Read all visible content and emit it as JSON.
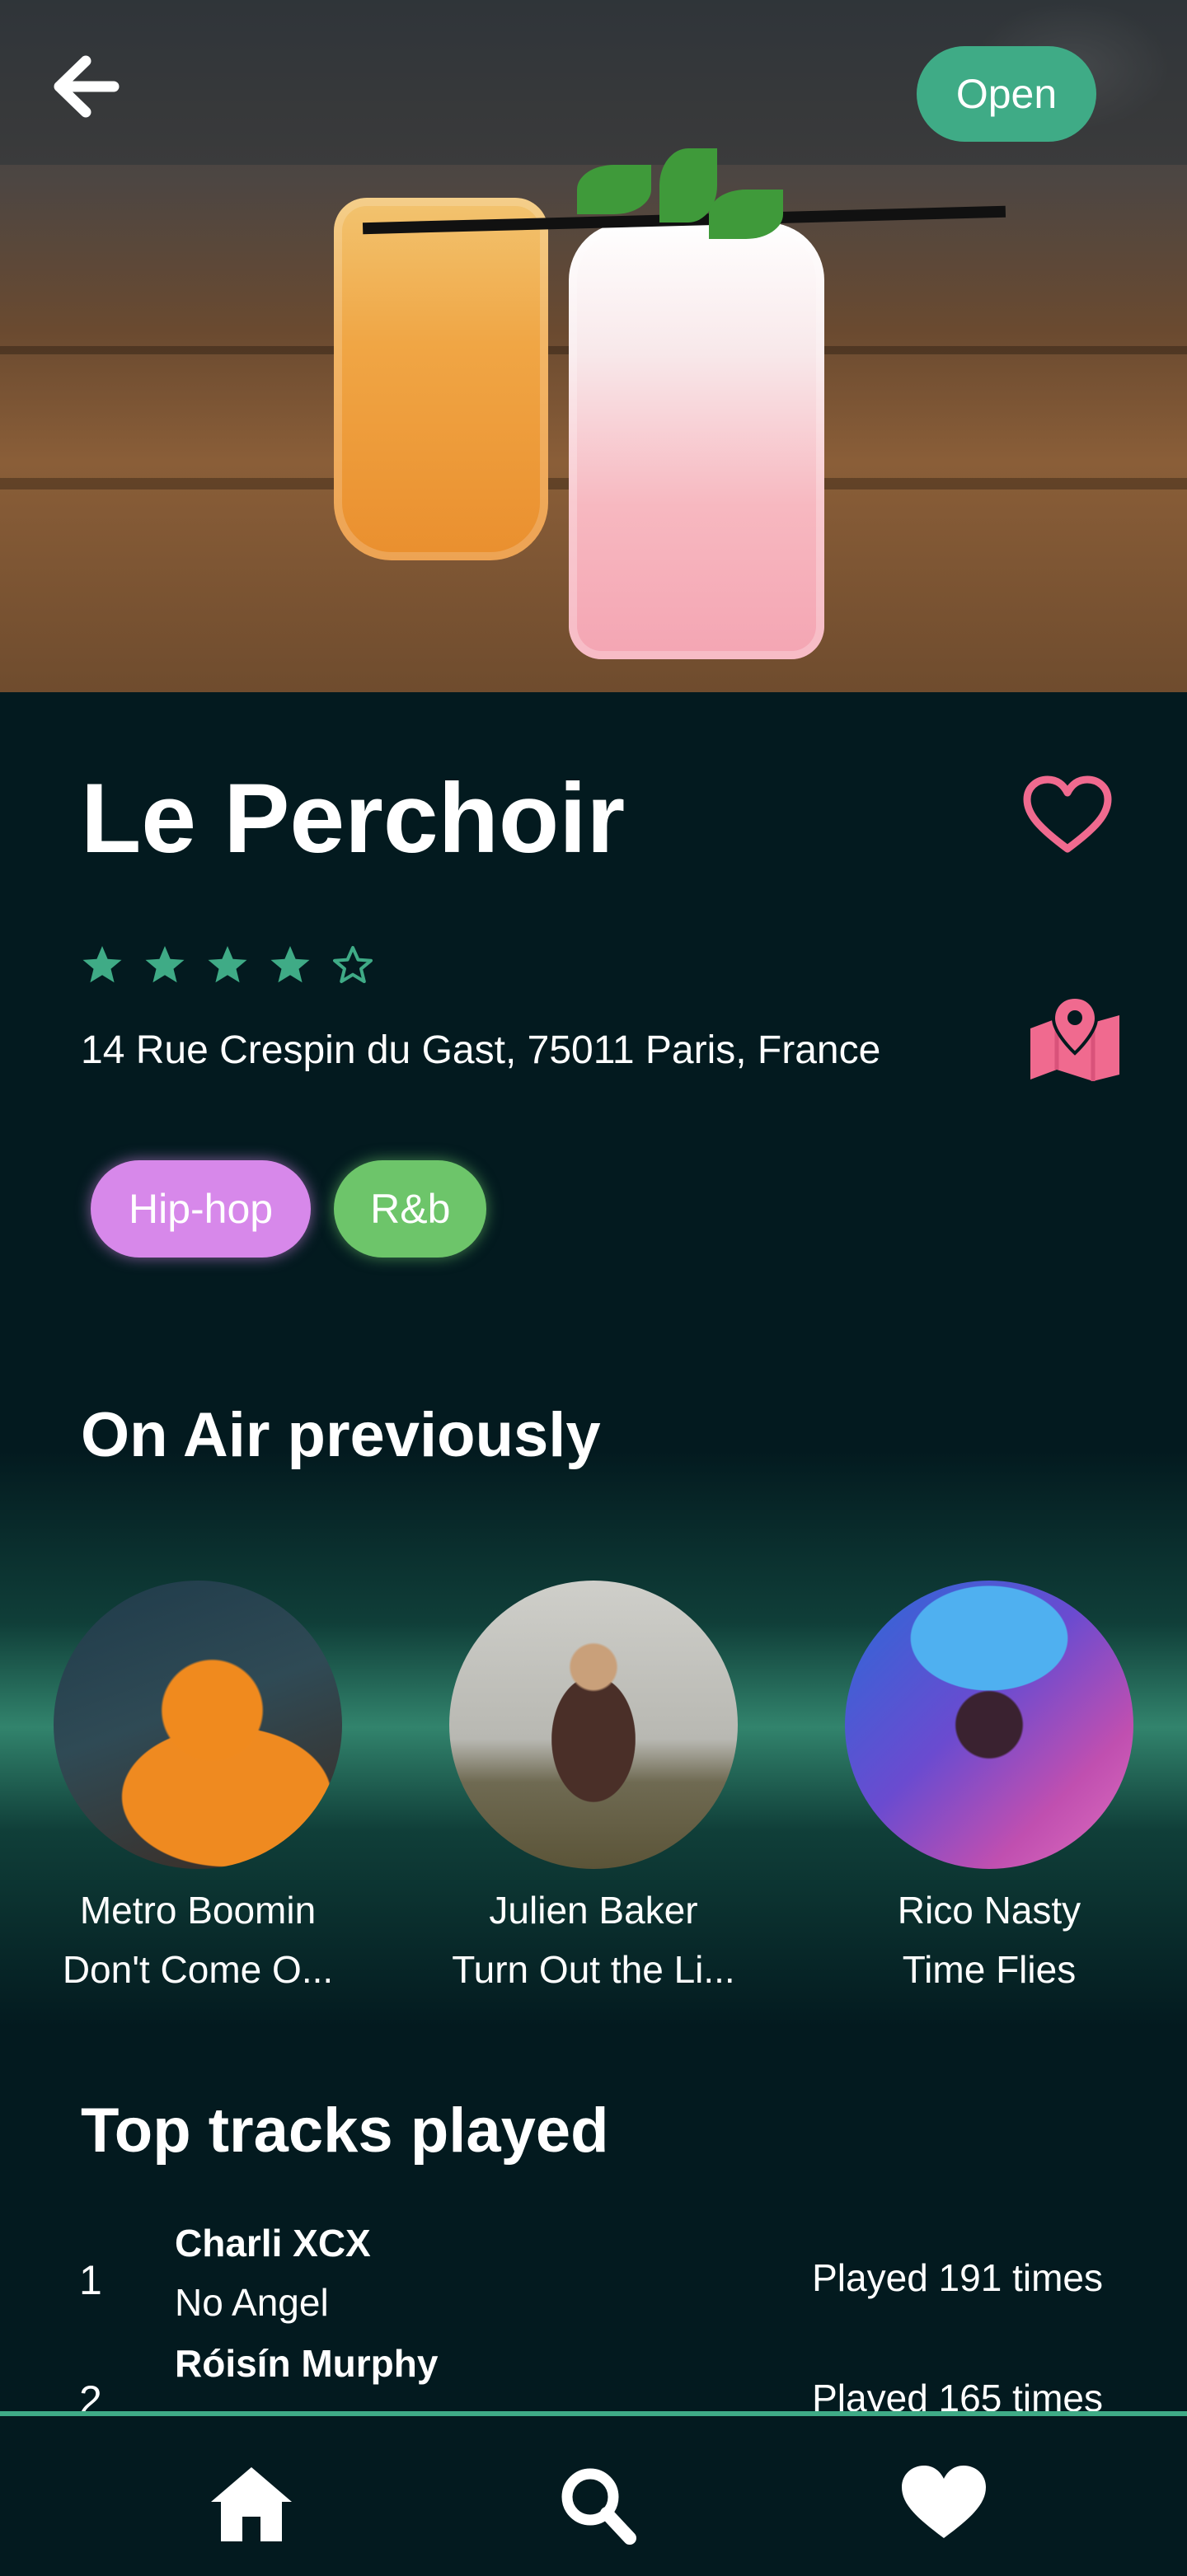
{
  "venue": {
    "status_badge": "Open",
    "name": "Le Perchoir",
    "rating": 4,
    "rating_max": 5,
    "address": "14 Rue Crespin du Gast, 75011 Paris, France",
    "tags": [
      "Hip-hop",
      "R&b"
    ]
  },
  "icons": {
    "back": "arrow-left-icon",
    "favorite": "heart-outline-icon",
    "map": "map-pin-icon",
    "star_filled": "star-filled-icon",
    "star_empty": "star-outline-icon",
    "nav_home": "home-icon",
    "nav_search": "search-icon",
    "nav_favorites": "heart-icon"
  },
  "on_air": {
    "title": "On Air previously",
    "artists": [
      {
        "name": "Metro Boomin",
        "track": "Don't Come O..."
      },
      {
        "name": "Julien Baker",
        "track": "Turn Out the Li..."
      },
      {
        "name": "Rico Nasty",
        "track": "Time Flies"
      }
    ]
  },
  "top_tracks": {
    "title": "Top tracks played",
    "items": [
      {
        "rank": "1",
        "artist": "Charli XCX",
        "title": "No Angel",
        "played": "Played 191 times"
      },
      {
        "rank": "2",
        "artist": "Róisín Murphy",
        "title": "",
        "played": "Played 165 times"
      }
    ]
  },
  "colors": {
    "background": "#031a1f",
    "accent_green": "#3fab86",
    "pink": "#f06a8f",
    "tag_hiphop": "#d788ea",
    "tag_rnb": "#6dc56a"
  }
}
